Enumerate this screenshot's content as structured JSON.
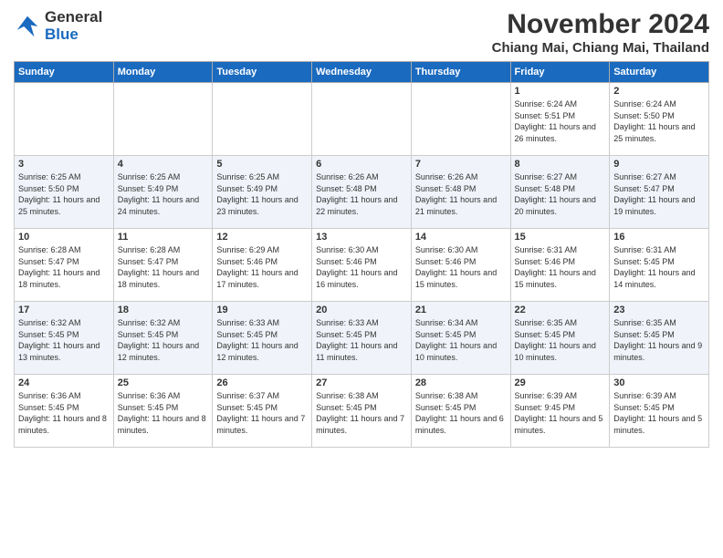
{
  "header": {
    "logo_line1": "General",
    "logo_line2": "Blue",
    "month": "November 2024",
    "location": "Chiang Mai, Chiang Mai, Thailand"
  },
  "weekdays": [
    "Sunday",
    "Monday",
    "Tuesday",
    "Wednesday",
    "Thursday",
    "Friday",
    "Saturday"
  ],
  "weeks": [
    [
      {
        "day": "",
        "info": ""
      },
      {
        "day": "",
        "info": ""
      },
      {
        "day": "",
        "info": ""
      },
      {
        "day": "",
        "info": ""
      },
      {
        "day": "",
        "info": ""
      },
      {
        "day": "1",
        "info": "Sunrise: 6:24 AM\nSunset: 5:51 PM\nDaylight: 11 hours and 26 minutes."
      },
      {
        "day": "2",
        "info": "Sunrise: 6:24 AM\nSunset: 5:50 PM\nDaylight: 11 hours and 25 minutes."
      }
    ],
    [
      {
        "day": "3",
        "info": "Sunrise: 6:25 AM\nSunset: 5:50 PM\nDaylight: 11 hours and 25 minutes."
      },
      {
        "day": "4",
        "info": "Sunrise: 6:25 AM\nSunset: 5:49 PM\nDaylight: 11 hours and 24 minutes."
      },
      {
        "day": "5",
        "info": "Sunrise: 6:25 AM\nSunset: 5:49 PM\nDaylight: 11 hours and 23 minutes."
      },
      {
        "day": "6",
        "info": "Sunrise: 6:26 AM\nSunset: 5:48 PM\nDaylight: 11 hours and 22 minutes."
      },
      {
        "day": "7",
        "info": "Sunrise: 6:26 AM\nSunset: 5:48 PM\nDaylight: 11 hours and 21 minutes."
      },
      {
        "day": "8",
        "info": "Sunrise: 6:27 AM\nSunset: 5:48 PM\nDaylight: 11 hours and 20 minutes."
      },
      {
        "day": "9",
        "info": "Sunrise: 6:27 AM\nSunset: 5:47 PM\nDaylight: 11 hours and 19 minutes."
      }
    ],
    [
      {
        "day": "10",
        "info": "Sunrise: 6:28 AM\nSunset: 5:47 PM\nDaylight: 11 hours and 18 minutes."
      },
      {
        "day": "11",
        "info": "Sunrise: 6:28 AM\nSunset: 5:47 PM\nDaylight: 11 hours and 18 minutes."
      },
      {
        "day": "12",
        "info": "Sunrise: 6:29 AM\nSunset: 5:46 PM\nDaylight: 11 hours and 17 minutes."
      },
      {
        "day": "13",
        "info": "Sunrise: 6:30 AM\nSunset: 5:46 PM\nDaylight: 11 hours and 16 minutes."
      },
      {
        "day": "14",
        "info": "Sunrise: 6:30 AM\nSunset: 5:46 PM\nDaylight: 11 hours and 15 minutes."
      },
      {
        "day": "15",
        "info": "Sunrise: 6:31 AM\nSunset: 5:46 PM\nDaylight: 11 hours and 15 minutes."
      },
      {
        "day": "16",
        "info": "Sunrise: 6:31 AM\nSunset: 5:45 PM\nDaylight: 11 hours and 14 minutes."
      }
    ],
    [
      {
        "day": "17",
        "info": "Sunrise: 6:32 AM\nSunset: 5:45 PM\nDaylight: 11 hours and 13 minutes."
      },
      {
        "day": "18",
        "info": "Sunrise: 6:32 AM\nSunset: 5:45 PM\nDaylight: 11 hours and 12 minutes."
      },
      {
        "day": "19",
        "info": "Sunrise: 6:33 AM\nSunset: 5:45 PM\nDaylight: 11 hours and 12 minutes."
      },
      {
        "day": "20",
        "info": "Sunrise: 6:33 AM\nSunset: 5:45 PM\nDaylight: 11 hours and 11 minutes."
      },
      {
        "day": "21",
        "info": "Sunrise: 6:34 AM\nSunset: 5:45 PM\nDaylight: 11 hours and 10 minutes."
      },
      {
        "day": "22",
        "info": "Sunrise: 6:35 AM\nSunset: 5:45 PM\nDaylight: 11 hours and 10 minutes."
      },
      {
        "day": "23",
        "info": "Sunrise: 6:35 AM\nSunset: 5:45 PM\nDaylight: 11 hours and 9 minutes."
      }
    ],
    [
      {
        "day": "24",
        "info": "Sunrise: 6:36 AM\nSunset: 5:45 PM\nDaylight: 11 hours and 8 minutes."
      },
      {
        "day": "25",
        "info": "Sunrise: 6:36 AM\nSunset: 5:45 PM\nDaylight: 11 hours and 8 minutes."
      },
      {
        "day": "26",
        "info": "Sunrise: 6:37 AM\nSunset: 5:45 PM\nDaylight: 11 hours and 7 minutes."
      },
      {
        "day": "27",
        "info": "Sunrise: 6:38 AM\nSunset: 5:45 PM\nDaylight: 11 hours and 7 minutes."
      },
      {
        "day": "28",
        "info": "Sunrise: 6:38 AM\nSunset: 5:45 PM\nDaylight: 11 hours and 6 minutes."
      },
      {
        "day": "29",
        "info": "Sunrise: 6:39 AM\nSunset: 9:45 PM\nDaylight: 11 hours and 5 minutes."
      },
      {
        "day": "30",
        "info": "Sunrise: 6:39 AM\nSunset: 5:45 PM\nDaylight: 11 hours and 5 minutes."
      }
    ]
  ]
}
